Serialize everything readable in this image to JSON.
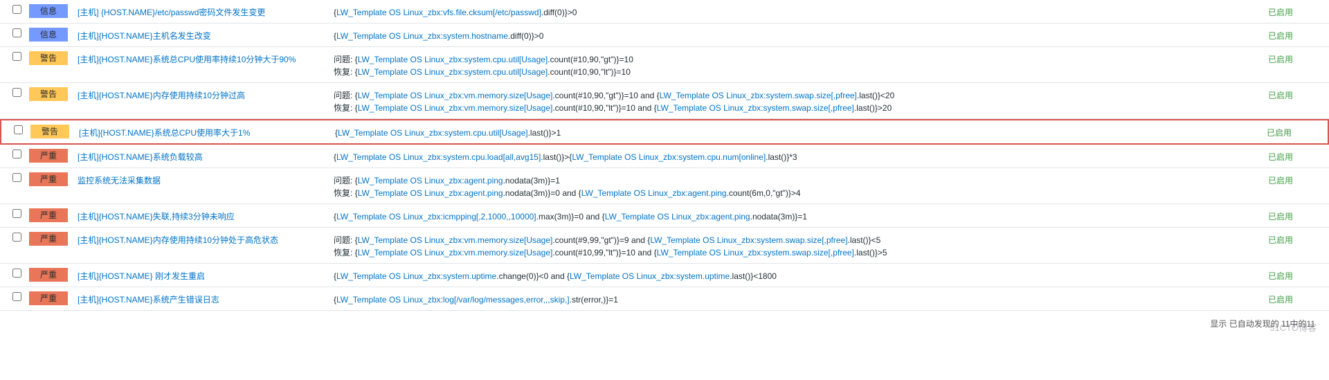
{
  "template_link": "LW_Template OS Linux_zbx",
  "status_enabled": "已启用",
  "severities": {
    "info": "信息",
    "warn": "警告",
    "high": "严重"
  },
  "rows": [
    {
      "sev": "info",
      "name": "[主机] {HOST.NAME}/etc/passwd密码文件发生变更",
      "expr": [
        {
          "parts": [
            "{",
            {
              "l": "LW_Template OS Linux_zbx:vfs.file.cksum[/etc/passwd]"
            },
            ".diff(0)}>0"
          ]
        }
      ]
    },
    {
      "sev": "info",
      "name": "[主机]{HOST.NAME}主机名发生改变",
      "expr": [
        {
          "parts": [
            "{",
            {
              "l": "LW_Template OS Linux_zbx:system.hostname"
            },
            ".diff(0)}>0"
          ]
        }
      ]
    },
    {
      "sev": "warn",
      "name": "[主机]{HOST.NAME}系统总CPU使用率持续10分钟大于90%",
      "expr": [
        {
          "prefix": "问题: ",
          "parts": [
            "{",
            {
              "l": "LW_Template OS Linux_zbx:system.cpu.util[Usage]"
            },
            ".count(#10,90,\"gt\")}=10"
          ]
        },
        {
          "prefix": "恢复: ",
          "parts": [
            "{",
            {
              "l": "LW_Template OS Linux_zbx:system.cpu.util[Usage]"
            },
            ".count(#10,90,\"lt\")}=10"
          ]
        }
      ]
    },
    {
      "sev": "warn",
      "name": "[主机]{HOST.NAME}内存使用持续10分钟过高",
      "expr": [
        {
          "prefix": "问题: ",
          "parts": [
            "{",
            {
              "l": "LW_Template OS Linux_zbx:vm.memory.size[Usage]"
            },
            ".count(#10,90,\"gt\")}=10 and {",
            {
              "l": "LW_Template OS Linux_zbx:system.swap.size[,pfree]"
            },
            ".last()}<20"
          ]
        },
        {
          "prefix": "恢复: ",
          "parts": [
            "{",
            {
              "l": "LW_Template OS Linux_zbx:vm.memory.size[Usage]"
            },
            ".count(#10,90,\"lt\")}=10 and {",
            {
              "l": "LW_Template OS Linux_zbx:system.swap.size[,pfree]"
            },
            ".last()}>20"
          ]
        }
      ]
    },
    {
      "sev": "warn",
      "highlight": true,
      "name": "[主机]{HOST.NAME}系统总CPU使用率大于1%",
      "expr": [
        {
          "parts": [
            "{",
            {
              "l": "LW_Template OS Linux_zbx:system.cpu.util[Usage]"
            },
            ".last()}>1"
          ]
        }
      ]
    },
    {
      "sev": "high",
      "name": "[主机]{HOST.NAME}系统负载较高",
      "expr": [
        {
          "parts": [
            "{",
            {
              "l": "LW_Template OS Linux_zbx:system.cpu.load[all,avg15]"
            },
            ".last()}>{",
            {
              "l": "LW_Template OS Linux_zbx:system.cpu.num[online]"
            },
            ".last()}*3"
          ]
        }
      ]
    },
    {
      "sev": "high",
      "name": "监控系统无法采集数据",
      "expr": [
        {
          "prefix": "问题: ",
          "parts": [
            "{",
            {
              "l": "LW_Template OS Linux_zbx:agent.ping"
            },
            ".nodata(3m)}=1"
          ]
        },
        {
          "prefix": "恢复: ",
          "parts": [
            "{",
            {
              "l": "LW_Template OS Linux_zbx:agent.ping"
            },
            ".nodata(3m)}=0 and {",
            {
              "l": "LW_Template OS Linux_zbx:agent.ping"
            },
            ".count(6m,0,\"gt\")}>4"
          ]
        }
      ]
    },
    {
      "sev": "high",
      "name": "[主机]{HOST.NAME}失联,持续3分钟未响应",
      "expr": [
        {
          "parts": [
            "{",
            {
              "l": "LW_Template OS Linux_zbx:icmpping[,2,1000,,10000]"
            },
            ".max(3m)}=0 and {",
            {
              "l": "LW_Template OS Linux_zbx:agent.ping"
            },
            ".nodata(3m)}=1"
          ]
        }
      ]
    },
    {
      "sev": "high",
      "name": "[主机]{HOST.NAME}内存使用持续10分钟处于高危状态",
      "expr": [
        {
          "prefix": "问题: ",
          "parts": [
            "{",
            {
              "l": "LW_Template OS Linux_zbx:vm.memory.size[Usage]"
            },
            ".count(#9,99,\"gt\")}=9 and {",
            {
              "l": "LW_Template OS Linux_zbx:system.swap.size[,pfree]"
            },
            ".last()}<5"
          ]
        },
        {
          "prefix": "恢复: ",
          "parts": [
            "{",
            {
              "l": "LW_Template OS Linux_zbx:vm.memory.size[Usage]"
            },
            ".count(#10,99,\"lt\")}=10 and {",
            {
              "l": "LW_Template OS Linux_zbx:system.swap.size[,pfree]"
            },
            ".last()}>5"
          ]
        }
      ]
    },
    {
      "sev": "high",
      "name": "[主机]{HOST.NAME} 刚才发生重启",
      "expr": [
        {
          "parts": [
            "{",
            {
              "l": "LW_Template OS Linux_zbx:system.uptime"
            },
            ".change(0)}<0 and {",
            {
              "l": "LW_Template OS Linux_zbx:system.uptime"
            },
            ".last()}<1800"
          ]
        }
      ]
    },
    {
      "sev": "high",
      "name": "[主机]{HOST.NAME}系统产生错误日志",
      "expr": [
        {
          "parts": [
            "{",
            {
              "l": "LW_Template OS Linux_zbx:log[/var/log/messages,error,,,skip,]"
            },
            ".str(error,)}=1"
          ]
        }
      ]
    }
  ],
  "footer_text": "显示 已自动发现的 11中的11",
  "watermark": "51CTO博客"
}
